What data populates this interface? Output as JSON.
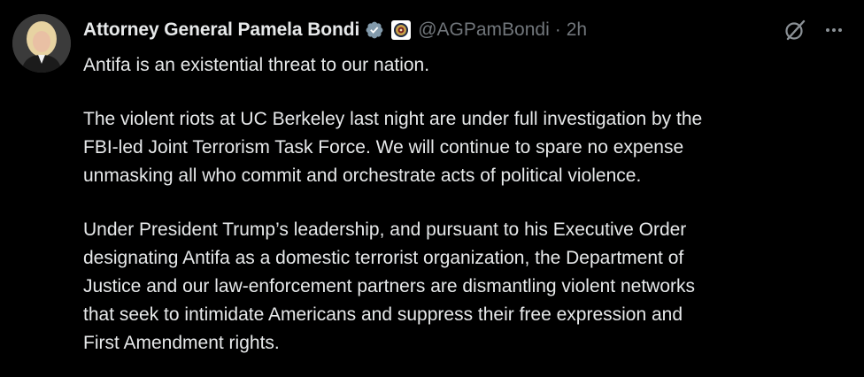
{
  "author": {
    "display_name": "Attorney General Pamela Bondi",
    "handle": "@AGPamBondi",
    "separator": "·",
    "time": "2h",
    "verified_icon": "verified-badge-icon",
    "affiliation_icon": "doj-seal-icon"
  },
  "actions": {
    "grok_icon": "grok-icon",
    "more_icon": "more-options-icon"
  },
  "tweet": {
    "paragraphs": [
      "Antifa is an existential threat to our nation.",
      "The violent riots at UC Berkeley last night are under full investigation by the\nFBI-led Joint Terrorism Task Force. We will continue to spare no expense\nunmasking all who commit and orchestrate acts of political violence.",
      "Under President Trump’s leadership, and pursuant to his Executive Order\ndesignating Antifa as a domestic terrorist organization, the Department of\nJustice and our law-enforcement partners are dismantling violent networks\nthat seek to intimidate Americans and suppress their free expression and\nFirst Amendment rights."
    ]
  },
  "colors": {
    "background": "#000000",
    "text": "#e7e9ea",
    "secondary_text": "#71767b",
    "verified": "#829aab"
  }
}
